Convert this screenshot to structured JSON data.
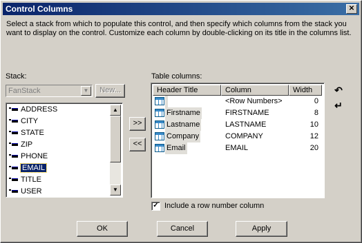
{
  "window": {
    "title": "Control Columns",
    "close_glyph": "✕"
  },
  "description": "Select a stack from which to populate this control, and then specify which columns from the stack you want to display on the control.  Customize each column by double-clicking on its title in the columns list.",
  "stack": {
    "label": "Stack:",
    "combo_value": "FanStack",
    "new_button": "New...",
    "items": [
      "ADDRESS",
      "CITY",
      "STATE",
      "ZIP",
      "PHONE",
      "EMAIL",
      "TITLE",
      "USER"
    ],
    "selected": "EMAIL"
  },
  "move_buttons": {
    "add": ">>",
    "remove": "<<"
  },
  "table_columns": {
    "label": "Table columns:",
    "headers": {
      "title": "Header Title",
      "column": "Column",
      "width": "Width"
    },
    "rows": [
      {
        "title": "",
        "column": "<Row Numbers>",
        "width": "0"
      },
      {
        "title": "Firstname",
        "column": "FIRSTNAME",
        "width": "8"
      },
      {
        "title": "Lastname",
        "column": "LASTNAME",
        "width": "10"
      },
      {
        "title": "Company",
        "column": "COMPANY",
        "width": "12"
      },
      {
        "title": "Email",
        "column": "EMAIL",
        "width": "20"
      }
    ]
  },
  "reorder": {
    "up_glyph": "↶",
    "down_glyph": "↵"
  },
  "include_row_number": {
    "label": "Include a row number column",
    "checked": true,
    "check_glyph": "✓"
  },
  "buttons": {
    "ok": "OK",
    "cancel": "Cancel",
    "apply": "Apply"
  }
}
